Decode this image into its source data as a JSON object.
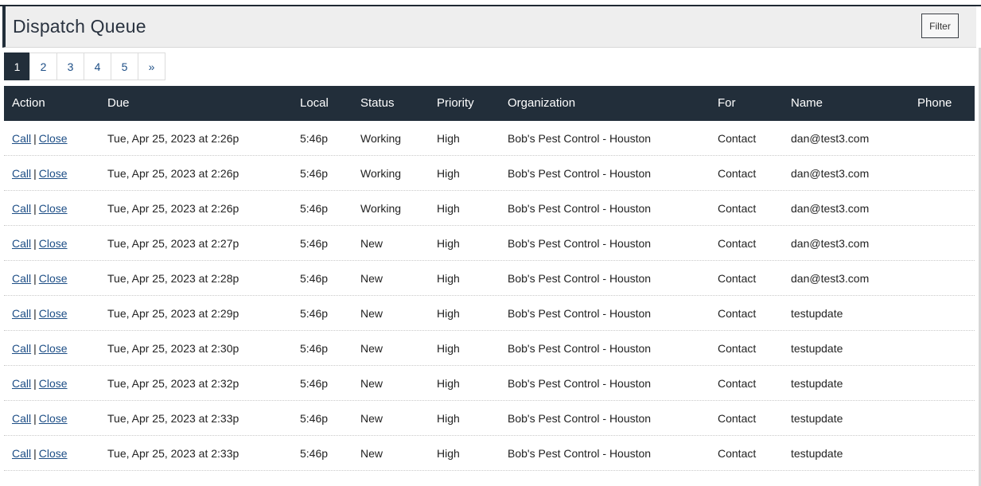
{
  "header": {
    "title": "Dispatch Queue",
    "filter_label": "Filter"
  },
  "pagination": {
    "pages": [
      "1",
      "2",
      "3",
      "4",
      "5"
    ],
    "next": "»",
    "current": "1"
  },
  "table": {
    "columns": [
      "Action",
      "Due",
      "Local",
      "Status",
      "Priority",
      "Organization",
      "For",
      "Name",
      "Phone"
    ],
    "call_label": "Call",
    "close_label": "Close",
    "separator": "|",
    "rows": [
      {
        "due": "Tue, Apr 25, 2023 at 2:26p",
        "local": "5:46p",
        "status": "Working",
        "priority": "High",
        "organization": "Bob's Pest Control - Houston",
        "for": "Contact",
        "name": "dan@test3.com",
        "phone": ""
      },
      {
        "due": "Tue, Apr 25, 2023 at 2:26p",
        "local": "5:46p",
        "status": "Working",
        "priority": "High",
        "organization": "Bob's Pest Control - Houston",
        "for": "Contact",
        "name": "dan@test3.com",
        "phone": ""
      },
      {
        "due": "Tue, Apr 25, 2023 at 2:26p",
        "local": "5:46p",
        "status": "Working",
        "priority": "High",
        "organization": "Bob's Pest Control - Houston",
        "for": "Contact",
        "name": "dan@test3.com",
        "phone": ""
      },
      {
        "due": "Tue, Apr 25, 2023 at 2:27p",
        "local": "5:46p",
        "status": "New",
        "priority": "High",
        "organization": "Bob's Pest Control - Houston",
        "for": "Contact",
        "name": "dan@test3.com",
        "phone": ""
      },
      {
        "due": "Tue, Apr 25, 2023 at 2:28p",
        "local": "5:46p",
        "status": "New",
        "priority": "High",
        "organization": "Bob's Pest Control - Houston",
        "for": "Contact",
        "name": "dan@test3.com",
        "phone": ""
      },
      {
        "due": "Tue, Apr 25, 2023 at 2:29p",
        "local": "5:46p",
        "status": "New",
        "priority": "High",
        "organization": "Bob's Pest Control - Houston",
        "for": "Contact",
        "name": "testupdate",
        "phone": ""
      },
      {
        "due": "Tue, Apr 25, 2023 at 2:30p",
        "local": "5:46p",
        "status": "New",
        "priority": "High",
        "organization": "Bob's Pest Control - Houston",
        "for": "Contact",
        "name": "testupdate",
        "phone": ""
      },
      {
        "due": "Tue, Apr 25, 2023 at 2:32p",
        "local": "5:46p",
        "status": "New",
        "priority": "High",
        "organization": "Bob's Pest Control - Houston",
        "for": "Contact",
        "name": "testupdate",
        "phone": ""
      },
      {
        "due": "Tue, Apr 25, 2023 at 2:33p",
        "local": "5:46p",
        "status": "New",
        "priority": "High",
        "organization": "Bob's Pest Control - Houston",
        "for": "Contact",
        "name": "testupdate",
        "phone": ""
      },
      {
        "due": "Tue, Apr 25, 2023 at 2:33p",
        "local": "5:46p",
        "status": "New",
        "priority": "High",
        "organization": "Bob's Pest Control - Houston",
        "for": "Contact",
        "name": "testupdate",
        "phone": ""
      }
    ]
  },
  "colors": {
    "header_bg": "#222e3a",
    "link": "#1d4e86",
    "title_bar_bg": "#eeeeee"
  }
}
